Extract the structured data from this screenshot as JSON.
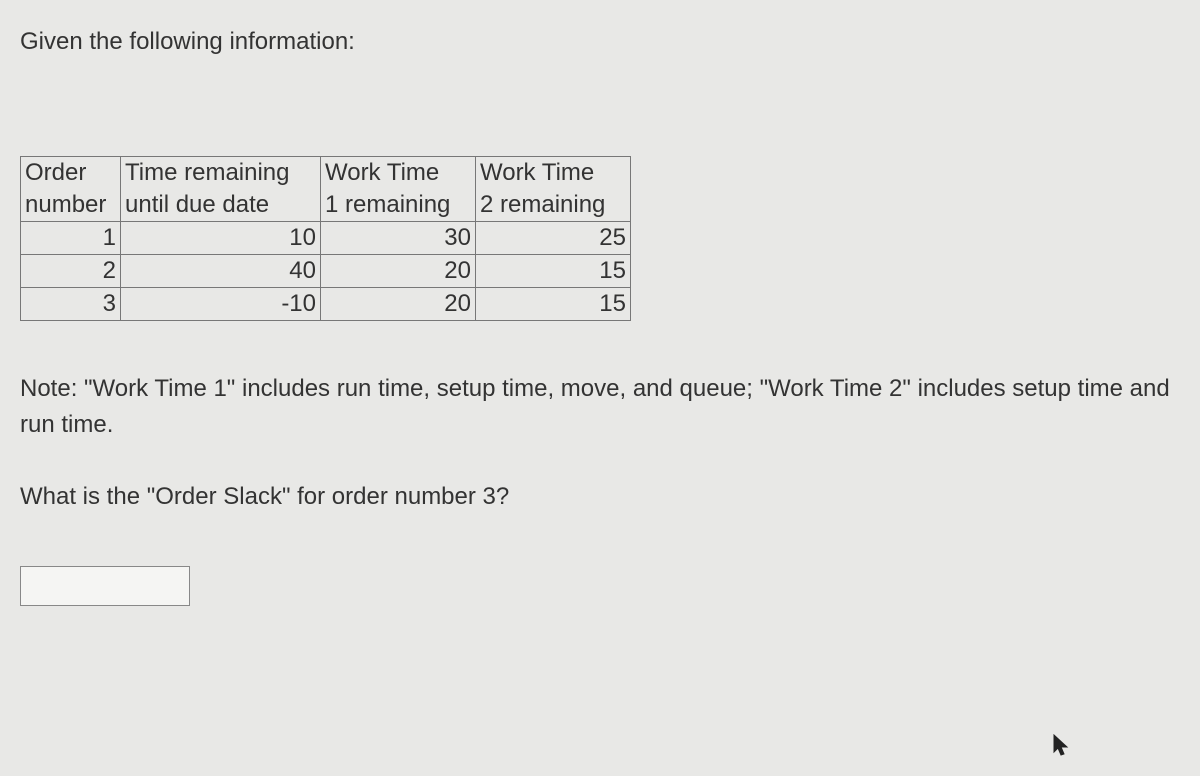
{
  "intro": "Given the following information:",
  "table": {
    "header1": [
      "Order",
      "Time remaining",
      "Work Time",
      "Work Time"
    ],
    "header2": [
      "number",
      "until due date",
      "1 remaining",
      "2 remaining"
    ],
    "rows": [
      {
        "order": "1",
        "time": "10",
        "work1": "30",
        "work2": "25"
      },
      {
        "order": "2",
        "time": "40",
        "work1": "20",
        "work2": "15"
      },
      {
        "order": "3",
        "time": "-10",
        "work1": "20",
        "work2": "15"
      }
    ]
  },
  "note": "Note: \"Work Time 1\" includes run time, setup time, move, and queue; \"Work Time 2\" includes setup time and run time.",
  "question": "What is the \"Order Slack\" for order number 3?",
  "answer_value": ""
}
